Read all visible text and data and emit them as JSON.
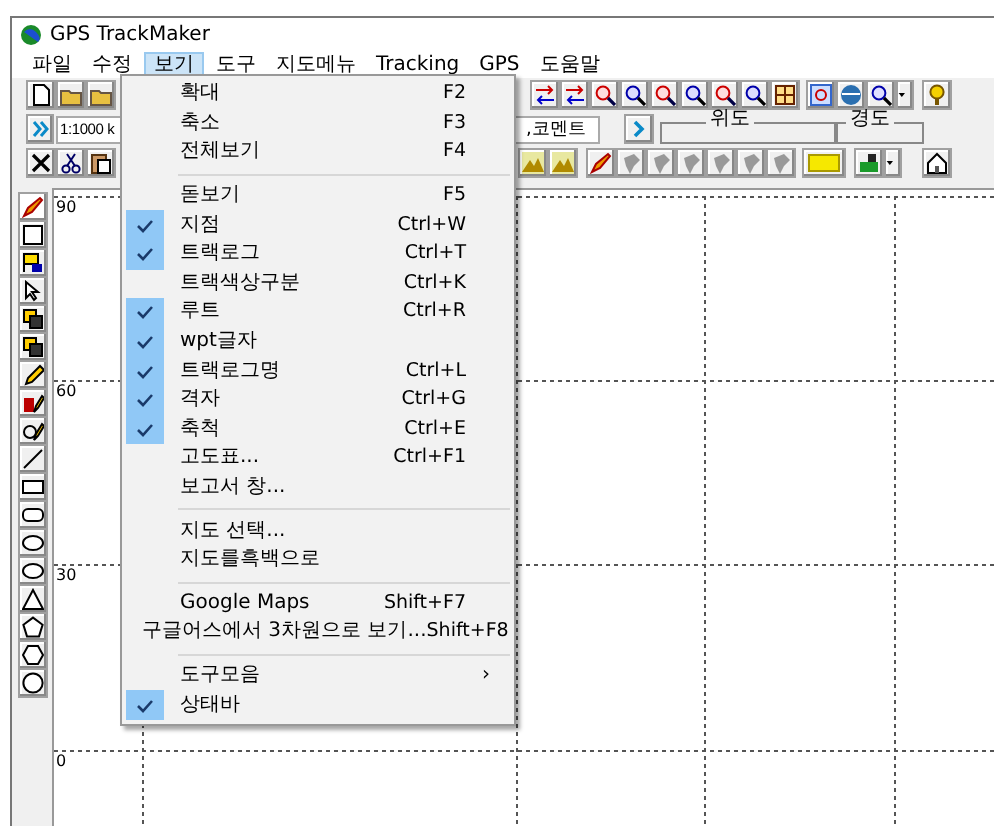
{
  "window": {
    "title": "GPS TrackMaker"
  },
  "menu_bar": [
    {
      "label": "파일",
      "selected": false
    },
    {
      "label": "수정",
      "selected": false
    },
    {
      "label": "보기",
      "selected": true
    },
    {
      "label": "도구",
      "selected": false
    },
    {
      "label": "지도메뉴",
      "selected": false
    },
    {
      "label": "Tracking",
      "selected": false
    },
    {
      "label": "GPS",
      "selected": false
    },
    {
      "label": "도움말",
      "selected": false
    }
  ],
  "toolbar": {
    "scale_field": {
      "value": "1:1000 k"
    },
    "comment_field": {
      "value": ",코멘트"
    },
    "latitude_label": "위도",
    "longitude_label": "경도"
  },
  "map": {
    "axis_labels": [
      "90",
      "60",
      "30",
      "0"
    ]
  },
  "view_menu": {
    "items": [
      {
        "kind": "item",
        "label": "확대",
        "shortcut": "F2",
        "checked": false
      },
      {
        "kind": "item",
        "label": "축소",
        "shortcut": "F3",
        "checked": false
      },
      {
        "kind": "item",
        "label": "전체보기",
        "shortcut": "F4",
        "checked": false
      },
      {
        "kind": "separator"
      },
      {
        "kind": "item",
        "label": "돋보기",
        "shortcut": "F5",
        "checked": false
      },
      {
        "kind": "item",
        "label": "지점",
        "shortcut": "Ctrl+W",
        "checked": true
      },
      {
        "kind": "item",
        "label": "트랙로그",
        "shortcut": "Ctrl+T",
        "checked": true
      },
      {
        "kind": "item",
        "label": "트랙색상구분",
        "shortcut": "Ctrl+K",
        "checked": false
      },
      {
        "kind": "item",
        "label": "루트",
        "shortcut": "Ctrl+R",
        "checked": true
      },
      {
        "kind": "item",
        "label": "wpt글자",
        "checked": true
      },
      {
        "kind": "item",
        "label": "트랙로그명",
        "shortcut": "Ctrl+L",
        "checked": true
      },
      {
        "kind": "item",
        "label": "격자",
        "shortcut": "Ctrl+G",
        "checked": true
      },
      {
        "kind": "item",
        "label": "축척",
        "shortcut": "Ctrl+E",
        "checked": true
      },
      {
        "kind": "item",
        "label": "고도표...",
        "shortcut": "Ctrl+F1",
        "checked": false
      },
      {
        "kind": "item",
        "label": "보고서 창...",
        "checked": false
      },
      {
        "kind": "separator"
      },
      {
        "kind": "item",
        "label": "지도 선택...",
        "checked": false
      },
      {
        "kind": "item",
        "label": "지도를흑백으로",
        "checked": false
      },
      {
        "kind": "separator"
      },
      {
        "kind": "item",
        "label": "Google Maps",
        "shortcut": "Shift+F7",
        "checked": false
      },
      {
        "kind": "item",
        "label": "구글어스에서 3차원으로 보기...",
        "shortcut": "Shift+F8",
        "checked": false
      },
      {
        "kind": "separator"
      },
      {
        "kind": "item",
        "label": "도구모음",
        "submenu_arrow": "›",
        "checked": false
      },
      {
        "kind": "item",
        "label": "상태바",
        "checked": true
      }
    ]
  }
}
